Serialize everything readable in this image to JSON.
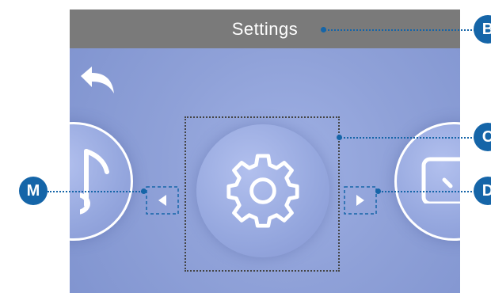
{
  "screen": {
    "title": "Settings",
    "background_color": "#8fa1d8",
    "titlebar_color": "#7a7a7a"
  },
  "icons": {
    "back": "back-arrow-icon",
    "music": "music-note-icon",
    "settings": "gear-icon",
    "next_item": "partial-square-icon",
    "left_arrow": "left-triangle-icon",
    "right_arrow": "right-triangle-icon"
  },
  "callouts": {
    "B": "B",
    "C": "C",
    "D": "D",
    "M": "M",
    "color": "#1565a8"
  }
}
